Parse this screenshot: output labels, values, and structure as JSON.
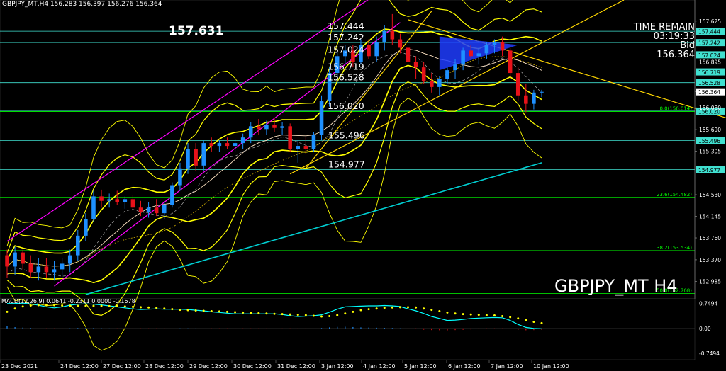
{
  "header": {
    "symbol_tf": "GBPJPY_MT,H4",
    "ohlc": "156.283 156.397 156.276 156.364"
  },
  "big_price": "157.631",
  "time_remain": {
    "label": "TIME REMAIN",
    "value": "03:19:33"
  },
  "bid": {
    "label": "Bid",
    "value": "156.364"
  },
  "symbol_label": "GBPJPY_MT H4",
  "macd_label": "MACD(12,26,9) 0.0641 -0.2311 0.0000 -0.1678",
  "colors": {
    "background": "#000000",
    "bull_candle": "#1e90ff",
    "bear_candle": "#e8121a",
    "band": "#ffff00",
    "level_line": "#40e0d0",
    "fib_line": "#00ff00",
    "channel": "#ff00ff",
    "trendline": "#ffd700",
    "ma_long": "#00ced1",
    "macd_signal": "#ffff00",
    "macd_main": "#00ffff"
  },
  "chart_data": [
    {
      "type": "candlestick",
      "title": "GBPJPY_MT,H4",
      "x": [
        "23 Dec 2021",
        "24 Dec 12:00",
        "27 Dec 12:00",
        "28 Dec 12:00",
        "29 Dec 12:00",
        "30 Dec 12:00",
        "31 Dec 12:00",
        "3 Jan 12:00",
        "4 Jan 12:00",
        "5 Jan 12:00",
        "6 Jan 12:00",
        "7 Jan 12:00",
        "10 Jan 12:00"
      ],
      "ylim": [
        152.7,
        157.9
      ],
      "y_ticks": [
        "157.625",
        "157.444",
        "157.242",
        "157.024",
        "156.895",
        "156.719",
        "156.528",
        "156.364",
        "156.080",
        "156.020",
        "155.690",
        "155.496",
        "155.305",
        "154.977",
        "154.530",
        "154.145",
        "153.760",
        "153.370",
        "152.985"
      ],
      "levels": [
        {
          "value": 157.444,
          "label": "157.444"
        },
        {
          "value": 157.242,
          "label": "157.242"
        },
        {
          "value": 157.024,
          "label": "157.024"
        },
        {
          "value": 156.719,
          "label": "156.719"
        },
        {
          "value": 156.528,
          "label": "156.528"
        },
        {
          "value": 156.02,
          "label": "156.020"
        },
        {
          "value": 155.496,
          "label": "155.496"
        },
        {
          "value": 154.977,
          "label": "154.977"
        }
      ],
      "fib_levels": [
        {
          "value": 156.014,
          "label": "0.0(156.014)"
        },
        {
          "value": 154.482,
          "label": "23.6(154.482)"
        },
        {
          "value": 153.534,
          "label": "38.2(153.534)"
        },
        {
          "value": 152.768,
          "label": "50.0(152.768)"
        }
      ],
      "current_price": 156.364,
      "candles": [
        [
          153.45,
          153.55,
          153.05,
          153.25
        ],
        [
          153.25,
          153.6,
          153.1,
          153.5
        ],
        [
          153.5,
          153.55,
          153.2,
          153.3
        ],
        [
          153.3,
          153.45,
          153.05,
          153.15
        ],
        [
          153.15,
          153.4,
          153.0,
          153.25
        ],
        [
          153.25,
          153.4,
          153.05,
          153.15
        ],
        [
          153.15,
          153.35,
          153.0,
          153.2
        ],
        [
          153.2,
          153.4,
          153.05,
          153.3
        ],
        [
          153.3,
          153.55,
          153.15,
          153.45
        ],
        [
          153.45,
          153.9,
          153.35,
          153.8
        ],
        [
          153.8,
          154.2,
          153.7,
          154.1
        ],
        [
          154.1,
          154.6,
          154.05,
          154.5
        ],
        [
          154.5,
          154.62,
          154.3,
          154.42
        ],
        [
          154.42,
          154.55,
          154.3,
          154.45
        ],
        [
          154.45,
          154.6,
          154.35,
          154.4
        ],
        [
          154.4,
          154.5,
          154.28,
          154.45
        ],
        [
          154.45,
          154.52,
          154.25,
          154.3
        ],
        [
          154.3,
          154.42,
          154.15,
          154.22
        ],
        [
          154.22,
          154.4,
          154.12,
          154.3
        ],
        [
          154.3,
          154.45,
          154.15,
          154.2
        ],
        [
          154.2,
          154.4,
          154.1,
          154.35
        ],
        [
          154.35,
          154.75,
          154.3,
          154.7
        ],
        [
          154.7,
          155.1,
          154.6,
          155.0
        ],
        [
          155.0,
          155.45,
          154.9,
          155.35
        ],
        [
          155.35,
          155.45,
          154.95,
          155.05
        ],
        [
          155.05,
          155.5,
          154.95,
          155.45
        ],
        [
          155.45,
          155.55,
          155.3,
          155.4
        ],
        [
          155.4,
          155.5,
          155.3,
          155.45
        ],
        [
          155.45,
          155.55,
          155.35,
          155.4
        ],
        [
          155.4,
          155.52,
          155.3,
          155.45
        ],
        [
          155.45,
          155.62,
          155.35,
          155.55
        ],
        [
          155.55,
          155.82,
          155.45,
          155.75
        ],
        [
          155.75,
          155.88,
          155.6,
          155.7
        ],
        [
          155.7,
          155.85,
          155.6,
          155.78
        ],
        [
          155.78,
          155.9,
          155.65,
          155.72
        ],
        [
          155.72,
          155.82,
          155.6,
          155.75
        ],
        [
          155.75,
          155.8,
          155.3,
          155.35
        ],
        [
          155.35,
          155.5,
          155.1,
          155.4
        ],
        [
          155.4,
          155.55,
          155.25,
          155.35
        ],
        [
          155.35,
          155.65,
          155.3,
          155.6
        ],
        [
          155.6,
          156.3,
          155.5,
          156.2
        ],
        [
          156.2,
          156.8,
          156.1,
          156.7
        ],
        [
          156.7,
          157.1,
          156.5,
          157.0
        ],
        [
          157.0,
          157.2,
          156.85,
          157.1
        ],
        [
          157.1,
          157.2,
          156.8,
          156.9
        ],
        [
          156.9,
          157.3,
          156.85,
          157.2
        ],
        [
          157.2,
          157.3,
          156.95,
          157.0
        ],
        [
          157.0,
          157.35,
          156.9,
          157.25
        ],
        [
          157.25,
          157.55,
          157.1,
          157.45
        ],
        [
          157.45,
          157.75,
          157.2,
          157.3
        ],
        [
          157.3,
          157.4,
          157.05,
          157.15
        ],
        [
          157.15,
          157.3,
          156.8,
          156.9
        ],
        [
          156.9,
          157.0,
          156.6,
          156.8
        ],
        [
          156.8,
          156.9,
          156.5,
          156.55
        ],
        [
          156.55,
          156.7,
          156.35,
          156.45
        ],
        [
          156.45,
          156.65,
          156.3,
          156.6
        ],
        [
          156.6,
          156.8,
          156.5,
          156.75
        ],
        [
          156.75,
          156.95,
          156.6,
          156.85
        ],
        [
          156.85,
          157.15,
          156.75,
          157.1
        ],
        [
          157.1,
          157.2,
          156.95,
          157.0
        ],
        [
          157.0,
          157.15,
          156.85,
          157.05
        ],
        [
          157.05,
          157.25,
          156.95,
          157.2
        ],
        [
          157.2,
          157.3,
          157.05,
          157.25
        ],
        [
          157.25,
          157.35,
          157.0,
          157.1
        ],
        [
          157.1,
          157.15,
          156.6,
          156.7
        ],
        [
          156.7,
          156.8,
          156.2,
          156.3
        ],
        [
          156.3,
          156.5,
          156.0,
          156.15
        ],
        [
          156.15,
          156.4,
          156.05,
          156.35
        ],
        [
          156.35,
          156.4,
          156.27,
          156.364
        ]
      ]
    },
    {
      "type": "histogram",
      "title": "MACD(12,26,9) 0.0641 -0.2311 0.0000 -0.1678",
      "y_ticks": [
        "0.7494",
        "0.00",
        "-0.7494"
      ],
      "ylim": [
        -0.9,
        0.85
      ],
      "histogram": [
        0.25,
        0.15,
        0.1,
        0.05,
        0.0,
        -0.05,
        -0.08,
        -0.04,
        0.02,
        0.05,
        0.06,
        0.05,
        0.03,
        0.01,
        -0.02,
        -0.04,
        -0.06,
        -0.07,
        -0.05,
        -0.03,
        -0.02,
        0.0,
        0.02,
        0.02,
        0.01,
        0.0,
        -0.02,
        -0.03,
        -0.04,
        -0.05,
        -0.04,
        -0.03,
        -0.02,
        -0.01,
        0.0,
        -0.01,
        -0.04,
        -0.05,
        -0.03,
        0.0,
        0.05,
        0.12,
        0.18,
        0.2,
        0.16,
        0.12,
        0.1,
        0.08,
        0.07,
        0.05,
        0.02,
        -0.05,
        -0.1,
        -0.15,
        -0.2,
        -0.22,
        -0.24,
        -0.2,
        -0.16,
        -0.12,
        -0.1,
        -0.08,
        -0.06,
        -0.05,
        -0.1,
        -0.18,
        -0.22,
        -0.2,
        -0.17
      ],
      "signal": [
        0.5,
        0.6,
        0.66,
        0.69,
        0.7,
        0.7,
        0.7,
        0.69,
        0.68,
        0.68,
        0.68,
        0.68,
        0.68,
        0.67,
        0.67,
        0.66,
        0.65,
        0.64,
        0.63,
        0.62,
        0.6,
        0.58,
        0.56,
        0.55,
        0.54,
        0.53,
        0.52,
        0.51,
        0.5,
        0.49,
        0.48,
        0.47,
        0.46,
        0.45,
        0.44,
        0.43,
        0.42,
        0.41,
        0.4,
        0.38,
        0.36,
        0.37,
        0.4,
        0.45,
        0.5,
        0.55,
        0.58,
        0.6,
        0.62,
        0.63,
        0.64,
        0.64,
        0.63,
        0.6,
        0.56,
        0.52,
        0.48,
        0.45,
        0.43,
        0.42,
        0.41,
        0.4,
        0.39,
        0.37,
        0.34,
        0.3,
        0.25,
        0.2,
        0.16
      ],
      "main": [
        0.75,
        0.75,
        0.76,
        0.74,
        0.7,
        0.65,
        0.62,
        0.65,
        0.7,
        0.73,
        0.74,
        0.73,
        0.71,
        0.68,
        0.65,
        0.62,
        0.59,
        0.57,
        0.58,
        0.59,
        0.58,
        0.58,
        0.58,
        0.57,
        0.55,
        0.53,
        0.5,
        0.48,
        0.46,
        0.44,
        0.44,
        0.44,
        0.44,
        0.44,
        0.44,
        0.42,
        0.38,
        0.36,
        0.37,
        0.38,
        0.41,
        0.49,
        0.58,
        0.65,
        0.66,
        0.67,
        0.68,
        0.68,
        0.69,
        0.68,
        0.66,
        0.59,
        0.53,
        0.45,
        0.36,
        0.3,
        0.24,
        0.25,
        0.27,
        0.3,
        0.31,
        0.32,
        0.33,
        0.32,
        0.24,
        0.12,
        0.03,
        0.0,
        -0.01
      ]
    }
  ]
}
